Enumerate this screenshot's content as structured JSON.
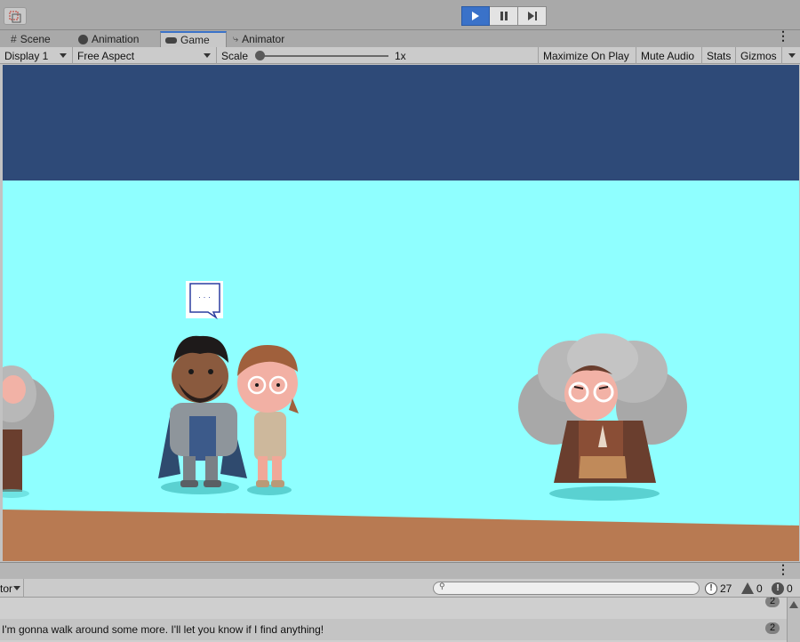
{
  "toolbar": {
    "play_controls": [
      "play",
      "pause",
      "step"
    ]
  },
  "tabs": [
    {
      "label": "Scene",
      "icon": "hash-icon"
    },
    {
      "label": "Animation",
      "icon": "animation-clock-icon"
    },
    {
      "label": "Game",
      "icon": "gamepad-icon",
      "active": true
    },
    {
      "label": "Animator",
      "icon": "animator-icon"
    }
  ],
  "game_toolbar": {
    "display": "Display 1",
    "aspect": "Free Aspect",
    "scale_label": "Scale",
    "scale_value": "1x",
    "scale_fraction": 0.0,
    "maximize": "Maximize On Play",
    "mute": "Mute Audio",
    "stats": "Stats",
    "gizmos": "Gizmos"
  },
  "scene": {
    "speech_bubble": "· · ·",
    "characters": [
      "knight",
      "young-woman",
      "elder-woman",
      "partial-elder-left"
    ]
  },
  "console": {
    "dropdown": "tor",
    "search_placeholder": "",
    "log_count": "27",
    "warning_count": "0",
    "error_count": "0",
    "rows": [
      {
        "text": "",
        "count": "2"
      },
      {
        "text": "I'm gonna walk around some more. I'll let you know if I find anything!",
        "count": "2"
      }
    ]
  },
  "colors": {
    "sky_top": "#2e4a78",
    "sky": "#8fffff",
    "ground": "#b87a52",
    "accent": "#3a72c9"
  }
}
